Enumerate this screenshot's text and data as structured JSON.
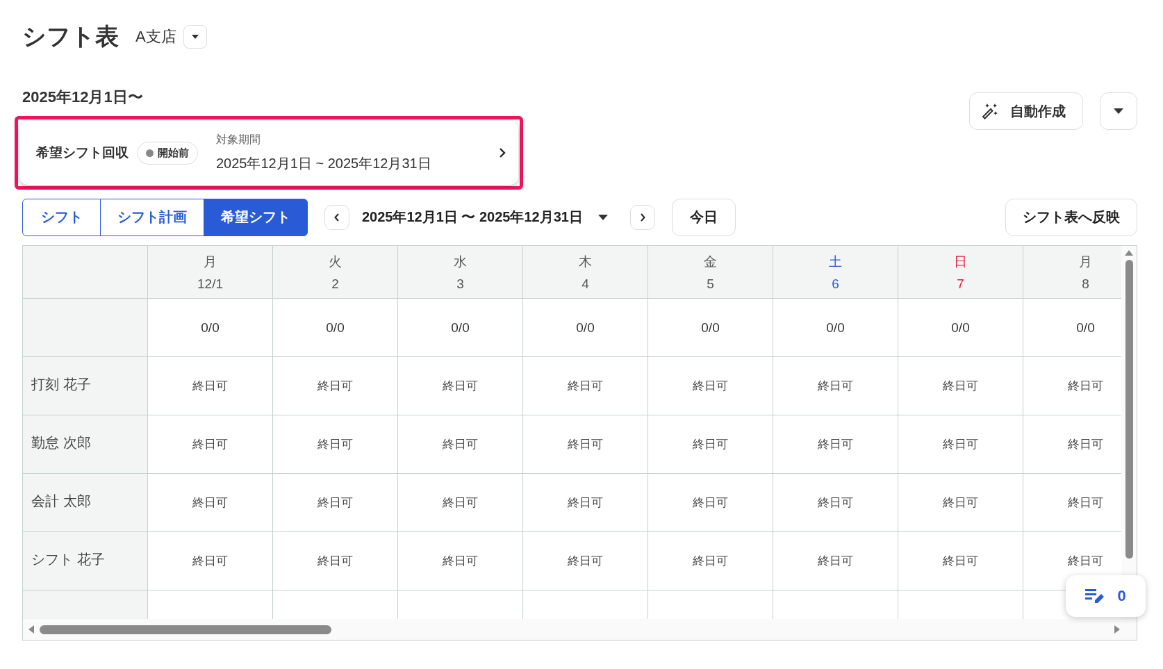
{
  "header": {
    "title": "シフト表",
    "store": "A支店"
  },
  "period_heading": "2025年12月1日〜",
  "auto_create_button": {
    "label": "自動作成"
  },
  "collection_card": {
    "highlighted": true,
    "title": "希望シフト回収",
    "status": "開始前",
    "period_label": "対象期間",
    "period": "2025年12月1日 ~ 2025年12月31日"
  },
  "view_tabs": [
    {
      "label": "シフト",
      "selected": false
    },
    {
      "label": "シフト計画",
      "selected": false
    },
    {
      "label": "希望シフト",
      "selected": true
    }
  ],
  "range": {
    "label": "2025年12月1日 〜 2025年12月31日"
  },
  "today_button": "今日",
  "apply_button": "シフト表へ反映",
  "table": {
    "days": [
      {
        "weekday": "月",
        "date": "12/1",
        "kind": "weekday",
        "count": "0/0"
      },
      {
        "weekday": "火",
        "date": "2",
        "kind": "weekday",
        "count": "0/0"
      },
      {
        "weekday": "水",
        "date": "3",
        "kind": "weekday",
        "count": "0/0"
      },
      {
        "weekday": "木",
        "date": "4",
        "kind": "weekday",
        "count": "0/0"
      },
      {
        "weekday": "金",
        "date": "5",
        "kind": "weekday",
        "count": "0/0"
      },
      {
        "weekday": "土",
        "date": "6",
        "kind": "saturday",
        "count": "0/0"
      },
      {
        "weekday": "日",
        "date": "7",
        "kind": "sunday",
        "count": "0/0"
      },
      {
        "weekday": "月",
        "date": "8",
        "kind": "weekday",
        "count": "0/0"
      }
    ],
    "rows": [
      {
        "name": "打刻 花子",
        "cells": [
          "終日可",
          "終日可",
          "終日可",
          "終日可",
          "終日可",
          "終日可",
          "終日可",
          "終日可"
        ]
      },
      {
        "name": "勤怠 次郎",
        "cells": [
          "終日可",
          "終日可",
          "終日可",
          "終日可",
          "終日可",
          "終日可",
          "終日可",
          "終日可"
        ]
      },
      {
        "name": "会計 太郎",
        "cells": [
          "終日可",
          "終日可",
          "終日可",
          "終日可",
          "終日可",
          "終日可",
          "終日可",
          "終日可"
        ]
      },
      {
        "name": "シフト 花子",
        "cells": [
          "終日可",
          "終日可",
          "終日可",
          "終日可",
          "終日可",
          "終日可",
          "終日可",
          "終日可"
        ]
      }
    ]
  },
  "floating_button": {
    "count": "0"
  }
}
